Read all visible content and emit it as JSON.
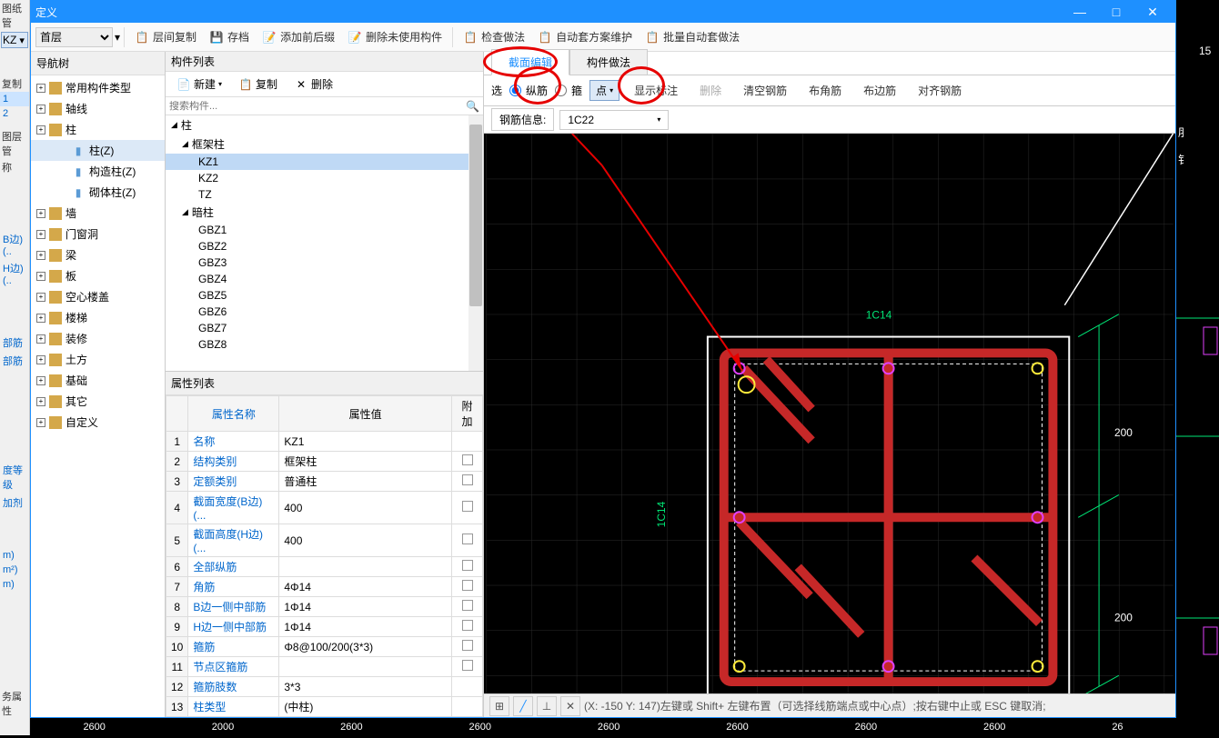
{
  "title": "定义",
  "left_strip": {
    "kz": "KZ",
    "tabs": [
      "图纸管",
      "复制",
      "图层管"
    ],
    "label1": "称",
    "items": [
      "1",
      "2"
    ],
    "b_side": "B边)(..",
    "h_side": "H边)(..",
    "bufjin1": "部筋",
    "bufjin2": "部筋",
    "du": "度等级",
    "jiaji": "加剂",
    "m1": "m)",
    "m2": "m²)",
    "m3": "m)",
    "member": "务属性"
  },
  "floor_select": "首层",
  "toolbar": [
    {
      "icon": "copy",
      "label": "层间复制"
    },
    {
      "icon": "save",
      "label": "存档"
    },
    {
      "icon": "prefix",
      "label": "添加前后缀"
    },
    {
      "icon": "del",
      "label": "删除未使用构件"
    },
    {
      "icon": "check",
      "label": "检查做法"
    },
    {
      "icon": "auto",
      "label": "自动套方案维护"
    },
    {
      "icon": "batch",
      "label": "批量自动套做法"
    }
  ],
  "nav": {
    "header": "导航树",
    "items": [
      {
        "label": "常用构件类型",
        "exp": true
      },
      {
        "label": "轴线",
        "exp": true
      },
      {
        "label": "柱",
        "exp": true,
        "children": [
          {
            "label": "柱(Z)",
            "icon": "col",
            "selected": true
          },
          {
            "label": "构造柱(Z)",
            "icon": "ccol"
          },
          {
            "label": "砌体柱(Z)",
            "icon": "mcol"
          }
        ]
      },
      {
        "label": "墙",
        "exp": true
      },
      {
        "label": "门窗洞",
        "exp": true
      },
      {
        "label": "梁",
        "exp": true
      },
      {
        "label": "板",
        "exp": true
      },
      {
        "label": "空心楼盖",
        "exp": true
      },
      {
        "label": "楼梯",
        "exp": true
      },
      {
        "label": "装修",
        "exp": true
      },
      {
        "label": "土方",
        "exp": true
      },
      {
        "label": "基础",
        "exp": true
      },
      {
        "label": "其它",
        "exp": true
      },
      {
        "label": "自定义",
        "exp": true
      }
    ]
  },
  "comp": {
    "header": "构件列表",
    "toolbar": {
      "new": "新建",
      "copy": "复制",
      "del": "删除"
    },
    "search_ph": "搜索构件...",
    "tree": [
      {
        "label": "柱",
        "lvl": 0
      },
      {
        "label": "框架柱",
        "lvl": 1
      },
      {
        "label": "KZ1",
        "lvl": 2,
        "selected": true
      },
      {
        "label": "KZ2",
        "lvl": 2
      },
      {
        "label": "TZ",
        "lvl": 2
      },
      {
        "label": "暗柱",
        "lvl": 1
      },
      {
        "label": "GBZ1",
        "lvl": 2
      },
      {
        "label": "GBZ2",
        "lvl": 2
      },
      {
        "label": "GBZ3",
        "lvl": 2
      },
      {
        "label": "GBZ4",
        "lvl": 2
      },
      {
        "label": "GBZ5",
        "lvl": 2
      },
      {
        "label": "GBZ6",
        "lvl": 2
      },
      {
        "label": "GBZ7",
        "lvl": 2
      },
      {
        "label": "GBZ8",
        "lvl": 2
      }
    ]
  },
  "props": {
    "header": "属性列表",
    "cols": {
      "name": "属性名称",
      "value": "属性值",
      "add": "附加"
    },
    "rows": [
      {
        "n": "1",
        "name": "名称",
        "value": "KZ1",
        "add": ""
      },
      {
        "n": "2",
        "name": "结构类别",
        "value": "框架柱",
        "add": "chk"
      },
      {
        "n": "3",
        "name": "定额类别",
        "value": "普通柱",
        "add": "chk"
      },
      {
        "n": "4",
        "name": "截面宽度(B边)(...",
        "value": "400",
        "add": "chk"
      },
      {
        "n": "5",
        "name": "截面高度(H边)(...",
        "value": "400",
        "add": "chk"
      },
      {
        "n": "6",
        "name": "全部纵筋",
        "value": "",
        "add": "chk"
      },
      {
        "n": "7",
        "name": "角筋",
        "value": "4Φ14",
        "add": "chk"
      },
      {
        "n": "8",
        "name": "B边一侧中部筋",
        "value": "1Φ14",
        "add": "chk"
      },
      {
        "n": "9",
        "name": "H边一侧中部筋",
        "value": "1Φ14",
        "add": "chk"
      },
      {
        "n": "10",
        "name": "箍筋",
        "value": "Φ8@100/200(3*3)",
        "add": "chk"
      },
      {
        "n": "11",
        "name": "节点区箍筋",
        "value": "",
        "add": "chk"
      },
      {
        "n": "12",
        "name": "箍筋肢数",
        "value": "3*3",
        "add": ""
      },
      {
        "n": "13",
        "name": "柱类型",
        "value": "(中柱)",
        "add": ""
      }
    ]
  },
  "tabs": {
    "section": "截面编辑",
    "method": "构件做法"
  },
  "canvas_toolbar": {
    "sel": "选",
    "longit": "纵筋",
    "stir": "箍",
    "point": "点",
    "anno": "显示标注",
    "del": "删除",
    "clear": "清空钢筋",
    "corner": "布角筋",
    "side": "布边筋",
    "align": "对齐钢筋"
  },
  "rebar_info": {
    "label": "钢筋信息:",
    "value": "1C22"
  },
  "canvas_labels": {
    "top": "1C14",
    "left": "1C14",
    "dim1": "200",
    "dim2": "200",
    "rightnum": "15"
  },
  "status": "(X: -150 Y: 147)左键或 Shift+ 左键布置（可选择线筋端点或中心点）;按右键中止或 ESC 键取消;",
  "ruler": [
    "2600",
    "2000",
    "2600",
    "2600",
    "2600",
    "2600",
    "2600",
    "2600",
    "26"
  ]
}
